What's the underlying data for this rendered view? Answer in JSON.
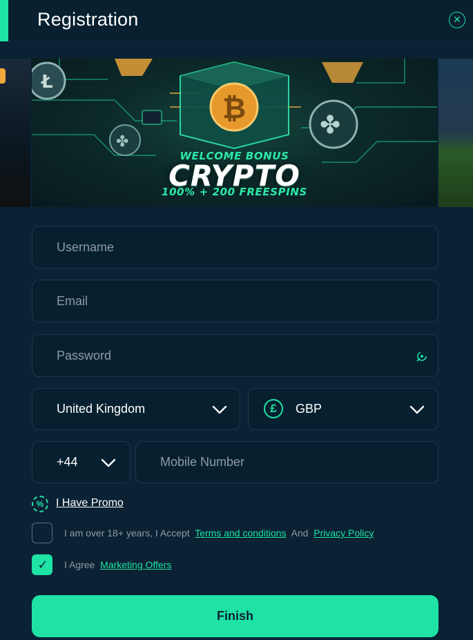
{
  "header": {
    "title": "Registration",
    "close_icon": "close-circle-icon"
  },
  "banner": {
    "line1": "WELCOME BONUS",
    "line2": "CRYPTO",
    "line3": "100% + 200 FREESPINS"
  },
  "form": {
    "username_placeholder": "Username",
    "email_placeholder": "Email",
    "password_placeholder": "Password",
    "country": "United Kingdom",
    "currency": "GBP",
    "currency_symbol": "£",
    "phone_code": "+44",
    "mobile_placeholder": "Mobile Number"
  },
  "promo": {
    "icon": "%",
    "label": "I Have Promo"
  },
  "terms": {
    "checked": false,
    "text_before": "I am over 18+ years, I Accept",
    "terms_link": "Terms and conditions",
    "and": "And",
    "privacy_link": "Privacy Policy"
  },
  "marketing": {
    "checked": true,
    "check_glyph": "✓",
    "text_before": "I Agree",
    "link": "Marketing Offers"
  },
  "finish_label": "Finish",
  "colors": {
    "accent": "#1fe2a5",
    "background": "#0a2233",
    "field": "#072030"
  }
}
